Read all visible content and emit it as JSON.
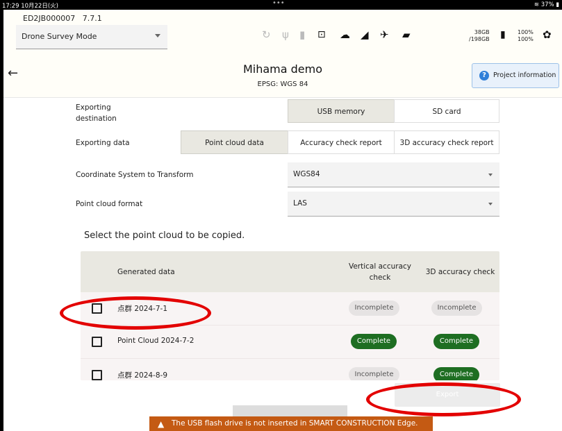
{
  "status_bar": {
    "time": "17:29  10月22日(火)",
    "dots": "•••",
    "battery": "37%"
  },
  "header": {
    "device_id": "ED2JB000007",
    "version": "7.7.1",
    "mode_select": {
      "value": "Drone Survey Mode"
    },
    "storage_free": "38GB",
    "storage_total": "/198GB",
    "battery_1": "100%",
    "battery_2": "100%",
    "icons": [
      "rotate-icon",
      "usb-icon",
      "sd-card-icon",
      "download-icon",
      "cloud-icon",
      "signal-icon",
      "satellite-icon",
      "folder-icon",
      "battery-icon",
      "gear-icon"
    ]
  },
  "title_bar": {
    "title": "Mihama demo",
    "subtitle": "EPSG: WGS 84",
    "project_info_label": "Project information"
  },
  "form": {
    "destination_label": "Exporting\ndestination",
    "destination_options": [
      "USB memory",
      "SD card"
    ],
    "destination_selected": "USB memory",
    "data_label": "Exporting data",
    "data_options": [
      "Point cloud data",
      "Accuracy check report",
      "3D accuracy check report"
    ],
    "data_selected": "Point cloud data",
    "coord_label": "Coordinate System to Transform",
    "coord_value": "WGS84",
    "format_label": "Point cloud format",
    "format_value": "LAS"
  },
  "table": {
    "section_title": "Select the point cloud to be copied.",
    "columns": [
      "Generated data",
      "Vertical accuracy\ncheck",
      "3D accuracy check"
    ],
    "rows": [
      {
        "name": "点群 2024-7-1",
        "vertical": "Incomplete",
        "accuracy3d": "Incomplete"
      },
      {
        "name": "Point Cloud 2024-7-2",
        "vertical": "Complete",
        "accuracy3d": "Complete"
      },
      {
        "name": "点群 2024-8-9",
        "vertical": "Incomplete",
        "accuracy3d": "Complete"
      }
    ]
  },
  "export_button": "Export",
  "warning": "The USB flash drive is not inserted in SMART CONSTRUCTION Edge.",
  "colors": {
    "complete": "#1e6e22",
    "warning": "#c45a13",
    "annotation": "#e30000",
    "accent": "#2f7fd8"
  }
}
